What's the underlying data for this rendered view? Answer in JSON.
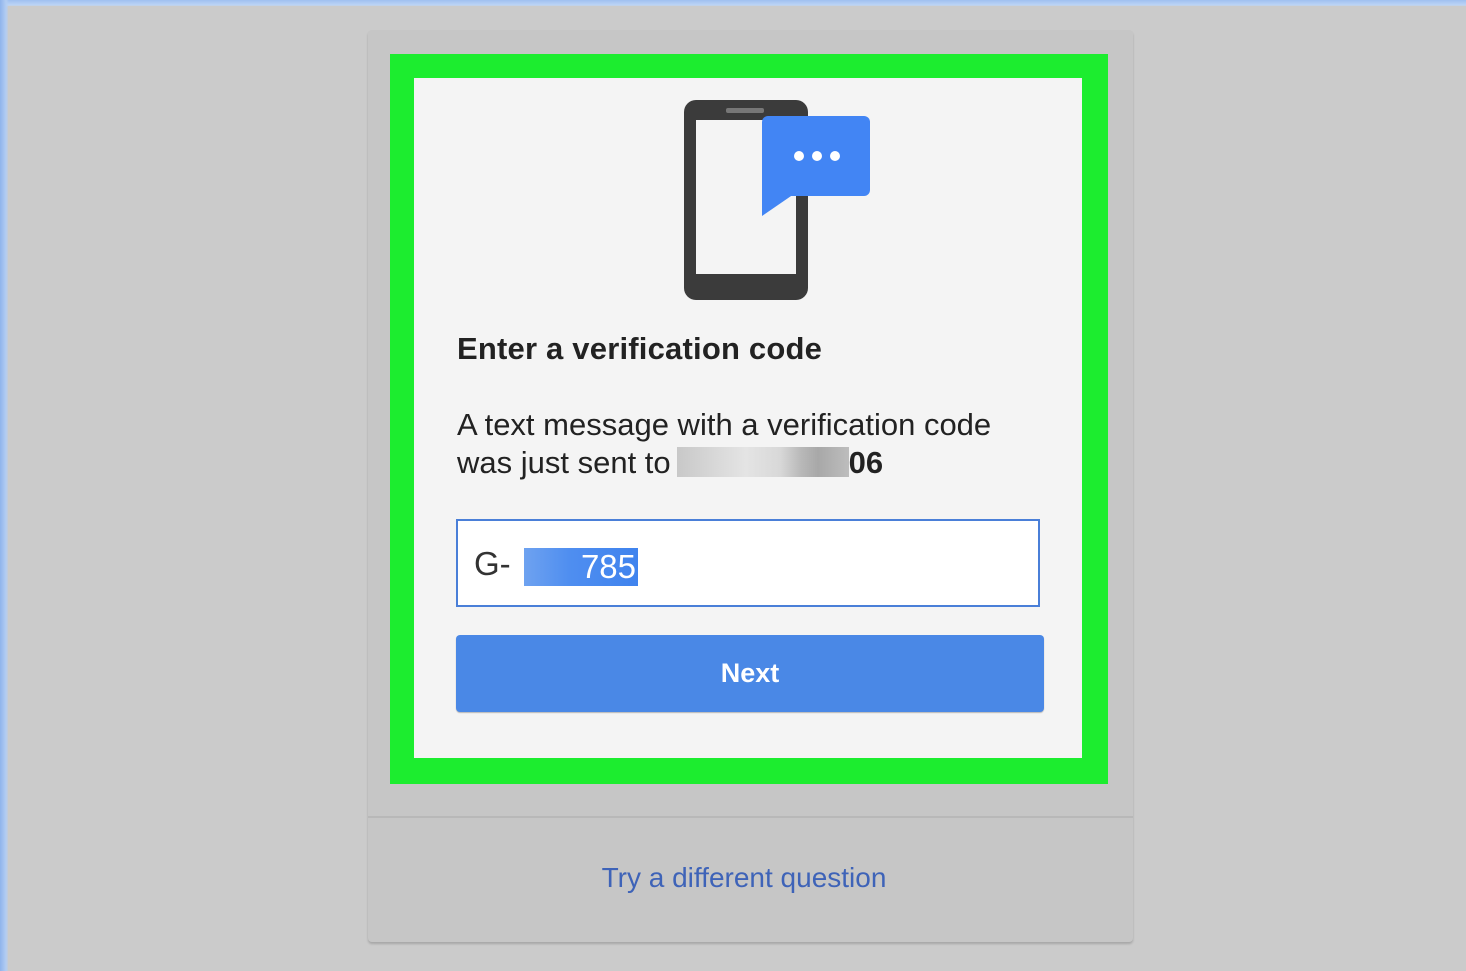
{
  "verification": {
    "title": "Enter a verification code",
    "message_line1": "A text message with a verification code",
    "message_line2": "was just sent to",
    "phone_suffix": "06",
    "code_prefix": "G-",
    "code_value": "785",
    "next_label": "Next",
    "alternate_link": "Try a different question"
  },
  "icons": {
    "illustration": "phone-with-message-bubble-icon"
  },
  "colors": {
    "highlight": "#1ced2f",
    "button": "#4a88e6",
    "link": "#3e63b8",
    "bubble": "#4285f4"
  }
}
